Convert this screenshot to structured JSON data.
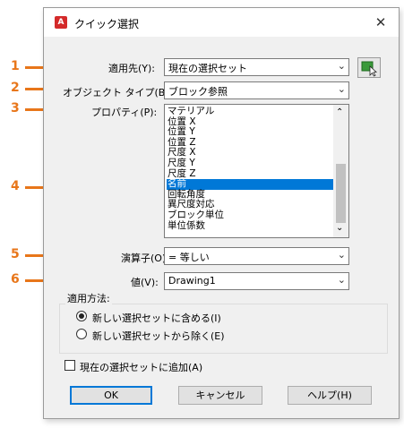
{
  "window": {
    "title": "クイック選択",
    "app_icon_letter": "A",
    "close_glyph": "✕"
  },
  "callouts": [
    "1",
    "2",
    "3",
    "4",
    "5",
    "6"
  ],
  "fields": {
    "apply_to": {
      "label": "適用先(Y):",
      "value": "現在の選択セット"
    },
    "object_type": {
      "label": "オブジェクト タイプ(B):",
      "value": "ブロック参照"
    },
    "properties": {
      "label": "プロパティ(P):",
      "items": [
        "マテリアル",
        "位置 X",
        "位置 Y",
        "位置 Z",
        "尺度 X",
        "尺度 Y",
        "尺度 Z",
        "名前",
        "回転角度",
        "異尺度対応",
        "ブロック単位",
        "単位係数"
      ],
      "selected": "名前"
    },
    "operator": {
      "label": "演算子(O):",
      "value": "= 等しい"
    },
    "value": {
      "label": "値(V):",
      "value": "Drawing1"
    }
  },
  "apply_method": {
    "legend": "適用方法:",
    "options": [
      {
        "label": "新しい選択セットに含める(I)",
        "selected": true
      },
      {
        "label": "新しい選択セットから除く(E)",
        "selected": false
      }
    ]
  },
  "append_checkbox": {
    "label": "現在の選択セットに追加(A)",
    "checked": false
  },
  "buttons": {
    "ok": "OK",
    "cancel": "キャンセル",
    "help": "ヘルプ(H)"
  },
  "icons": {
    "chevron": "⌄",
    "scroll_up": "⌃",
    "scroll_down": "⌄"
  },
  "colors": {
    "accent": "#e8761a",
    "selection": "#0078d7",
    "app_icon": "#d42a2a"
  }
}
